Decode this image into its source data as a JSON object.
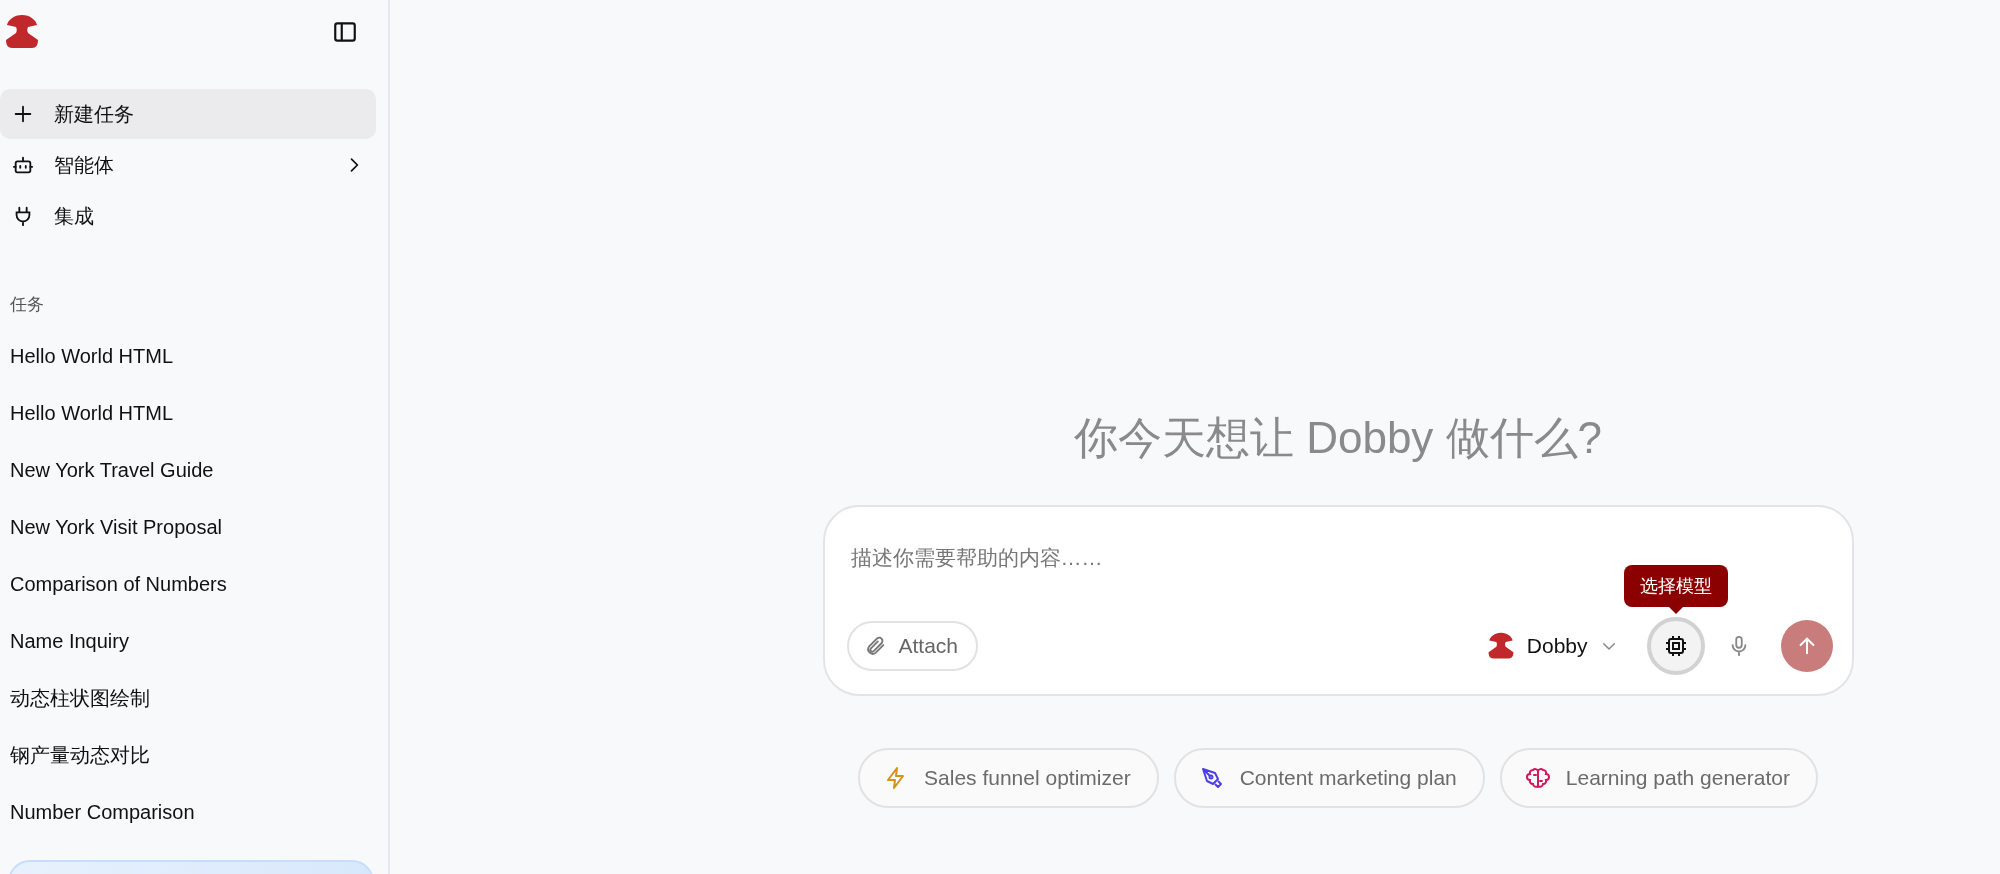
{
  "sidebar": {
    "nav": [
      {
        "kind": "new",
        "label": "新建任务",
        "selected": true,
        "has_submenu": false
      },
      {
        "kind": "agents",
        "label": "智能体",
        "selected": false,
        "has_submenu": true
      },
      {
        "kind": "integrations",
        "label": "集成",
        "selected": false,
        "has_submenu": false
      }
    ],
    "section_label": "任务",
    "tasks": [
      "Hello World HTML",
      "Hello World HTML",
      "New York Travel Guide",
      "New York Visit Proposal",
      "Comparison of Numbers",
      "Name Inquiry",
      "动态柱状图绘制",
      "钢产量动态对比",
      "Number Comparison"
    ]
  },
  "main": {
    "heading": "你今天想让 Dobby 做什么?",
    "composer": {
      "placeholder": "描述你需要帮助的内容……",
      "attach": "Attach",
      "model": "Dobby",
      "tooltip": "选择模型"
    },
    "suggestions": [
      {
        "kind": "bolt",
        "label": "Sales funnel optimizer",
        "color": "#d4941c"
      },
      {
        "kind": "pen",
        "label": "Content marketing plan",
        "color": "#4f3fe0"
      },
      {
        "kind": "brain",
        "label": "Learning path generator",
        "color": "#d0185a"
      }
    ]
  }
}
